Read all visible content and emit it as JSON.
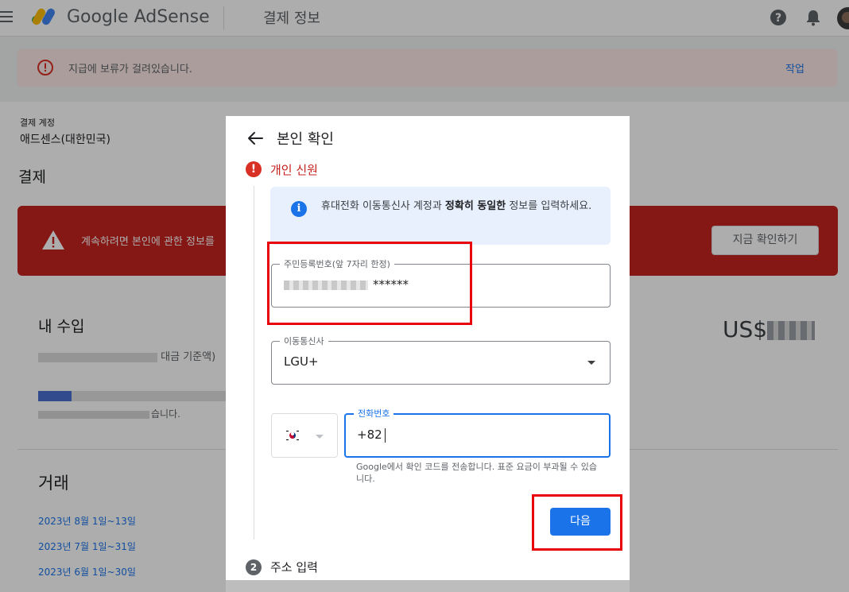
{
  "app": {
    "logo_text": "Google AdSense",
    "page_title": "결제 정보"
  },
  "hold_bar": {
    "message": "지급에 보류가 걸려있습니다.",
    "action": "작업"
  },
  "account": {
    "label": "결제 계정",
    "value": "애드센스(대한민국)"
  },
  "payments": {
    "title": "결제"
  },
  "alert": {
    "message": "계속하려면 본인에 관한 정보를",
    "button": "지금 확인하기"
  },
  "earnings": {
    "title": "내 수입",
    "subtitle_suffix": "대금 기준액)",
    "currency": "US$",
    "progress_note_suffix": "습니다.",
    "progress_fraction": 0.17
  },
  "transactions": {
    "title": "거래",
    "links": [
      "2023년 8월 1일~13일",
      "2023년 7월 1일~31일",
      "2023년 6월 1일~30일"
    ]
  },
  "dialog": {
    "title": "본인 확인",
    "step1": {
      "number": "!",
      "label": "개인 신원"
    },
    "info": {
      "part1": "휴대전화 이동통신사 계정과 ",
      "bold": "정확히 동일한",
      "part2": " 정보를 입력하세요."
    },
    "rrn": {
      "label": "주민등록번호(앞 7자리 한정)",
      "masked": "******"
    },
    "carrier": {
      "label": "이동통신사",
      "value": "LGU+"
    },
    "phone": {
      "label": "전화번호",
      "value": "+82"
    },
    "phone_hint": "Google에서 확인 코드를 전송합니다. 표준 요금이 부과될 수 있습니다.",
    "next_button": "다음",
    "step2": {
      "number": "2",
      "label": "주소 입력"
    }
  },
  "colors": {
    "brand_blue": "#1a73e8",
    "error_red": "#d93025",
    "alert_banner": "#c5221f",
    "highlight": "#e8000b"
  }
}
